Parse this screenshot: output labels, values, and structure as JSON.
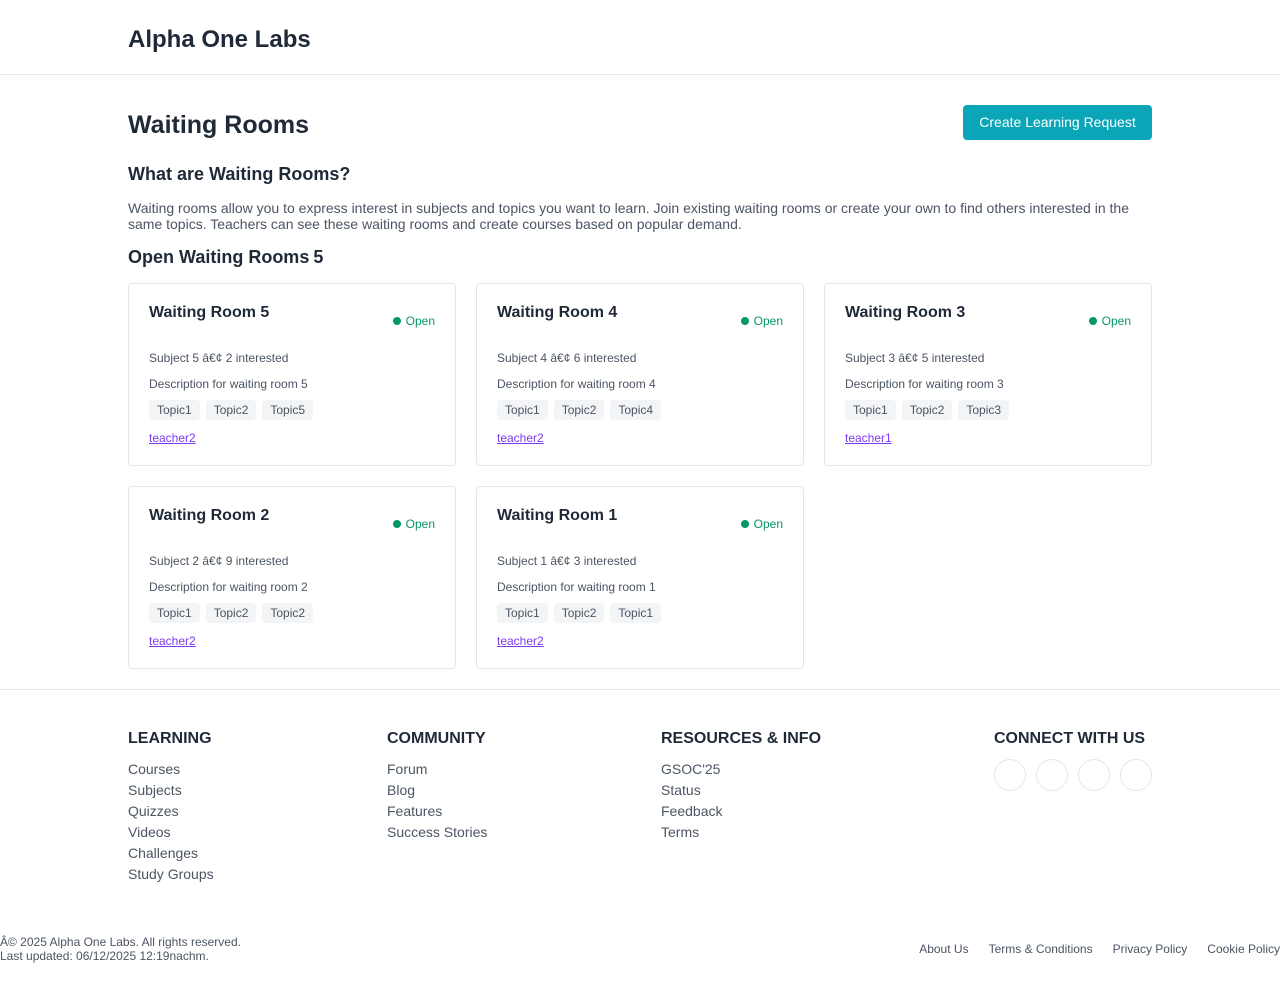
{
  "header": {
    "brand": "Alpha One Labs"
  },
  "main": {
    "title": "Waiting Rooms",
    "create_button": "Create Learning Request",
    "what_title": "What are Waiting Rooms?",
    "intro": "Waiting rooms allow you to express interest in subjects and topics you want to learn. Join existing waiting rooms or create your own to find others interested in the same topics. Teachers can see these waiting rooms and create courses based on popular demand.",
    "open_title": "Open Waiting Rooms",
    "open_count": "5",
    "colors": {
      "accent": "#0aa5b7",
      "open_status": "#059669",
      "teacher_link": "#7c3aed"
    },
    "rooms": [
      {
        "title": "Waiting Room 5",
        "status": "Open",
        "meta": "Subject 5 â€¢ 2 interested",
        "description": "Description for waiting room 5",
        "tags": [
          "Topic1",
          "Topic2",
          "Topic5"
        ],
        "teacher": "teacher2"
      },
      {
        "title": "Waiting Room 4",
        "status": "Open",
        "meta": "Subject 4 â€¢ 6 interested",
        "description": "Description for waiting room 4",
        "tags": [
          "Topic1",
          "Topic2",
          "Topic4"
        ],
        "teacher": "teacher2"
      },
      {
        "title": "Waiting Room 3",
        "status": "Open",
        "meta": "Subject 3 â€¢ 5 interested",
        "description": "Description for waiting room 3",
        "tags": [
          "Topic1",
          "Topic2",
          "Topic3"
        ],
        "teacher": "teacher1"
      },
      {
        "title": "Waiting Room 2",
        "status": "Open",
        "meta": "Subject 2 â€¢ 9 interested",
        "description": "Description for waiting room 2",
        "tags": [
          "Topic1",
          "Topic2",
          "Topic2"
        ],
        "teacher": "teacher2"
      },
      {
        "title": "Waiting Room 1",
        "status": "Open",
        "meta": "Subject 1 â€¢ 3 interested",
        "description": "Description for waiting room 1",
        "tags": [
          "Topic1",
          "Topic2",
          "Topic1"
        ],
        "teacher": "teacher2"
      }
    ]
  },
  "footer": {
    "learning": {
      "heading": "LEARNING",
      "links": [
        "Courses",
        "Subjects",
        "Quizzes",
        "Videos",
        "Challenges",
        "Study Groups"
      ]
    },
    "community": {
      "heading": "COMMUNITY",
      "links": [
        "Forum",
        "Blog",
        "Features",
        "Success Stories"
      ]
    },
    "resources": {
      "heading": "RESOURCES & INFO",
      "links": [
        "GSOC'25",
        "Status",
        "Feedback",
        "Terms"
      ]
    },
    "connect": {
      "heading": "CONNECT WITH US",
      "icons": [
        "social-icon-1",
        "social-icon-2",
        "social-icon-3",
        "social-icon-4"
      ]
    },
    "copyright": "Â© 2025 Alpha One Labs. All rights reserved.",
    "last_updated": "Last updated: 06/12/2025 12:19nachm.",
    "bottom_links": [
      "About Us",
      "Terms & Conditions",
      "Privacy Policy",
      "Cookie Policy"
    ]
  }
}
